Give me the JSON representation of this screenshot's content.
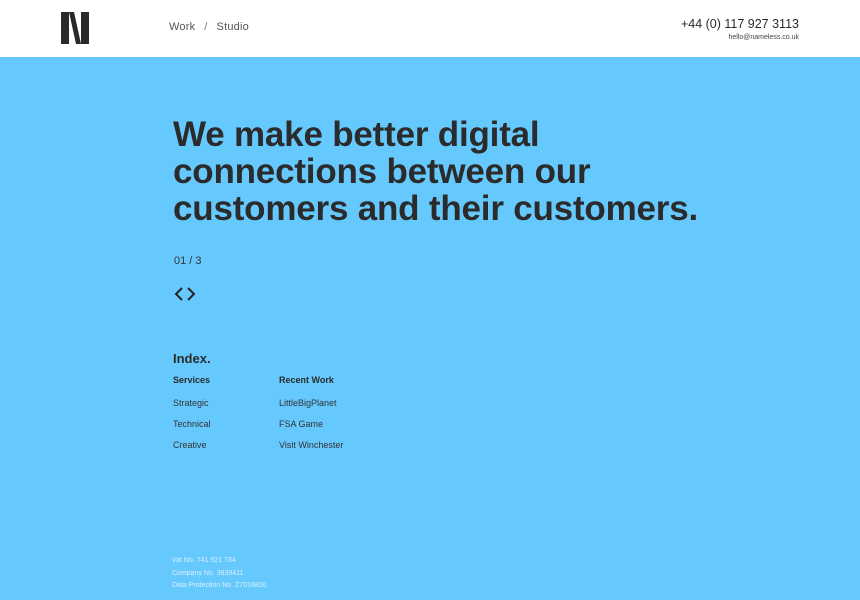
{
  "header": {
    "nav": {
      "work": "Work",
      "separator": "/",
      "studio": "Studio"
    },
    "phone": "+44 (0) 117 927 3113",
    "email": "hello@nameless.co.uk"
  },
  "hero": {
    "headline_line1": "We make better digital",
    "headline_line2": "connections between our",
    "headline_line3": "customers and their customers.",
    "counter": "01 / 3"
  },
  "index": {
    "title": "Index.",
    "services": {
      "heading": "Services",
      "items": [
        "Strategic",
        "Technical",
        "Creative"
      ]
    },
    "recent_work": {
      "heading": "Recent Work",
      "items": [
        "LittleBigPlanet",
        "FSA Game",
        "Visit Winchester"
      ]
    }
  },
  "footer": {
    "vat": "Vat No. 741 921 734",
    "company": "Company No. 3839411",
    "data_protection": "Data Protection No. Z7016820"
  },
  "colors": {
    "background": "#66c9fe",
    "topbar": "#ffffff",
    "text": "#2a2a2a"
  },
  "icons": {
    "logo": "n-logo-icon",
    "prev": "chevron-left-icon",
    "next": "chevron-right-icon"
  }
}
